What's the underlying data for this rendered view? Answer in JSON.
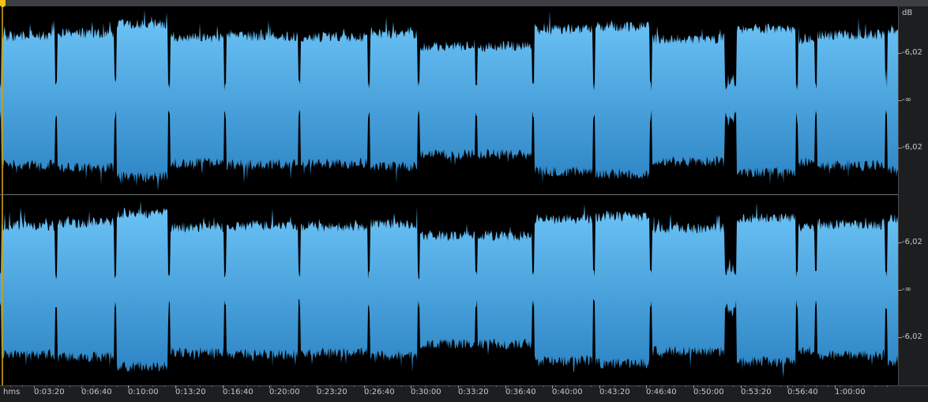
{
  "colors": {
    "background": "#000000",
    "wave_top": "#6ec5f8",
    "wave_bottom": "#2a82c2",
    "playhead": "#f1c40f",
    "ruler_text": "#c8c8c8"
  },
  "db_ruler": {
    "unit_label": "dB",
    "channels": [
      {
        "name": "top",
        "labels": [
          "-6,02",
          "-∞",
          "-6,02"
        ]
      },
      {
        "name": "bottom",
        "labels": [
          "-6,02",
          "-∞",
          "-6,02"
        ]
      }
    ]
  },
  "time_ruler": {
    "unit_label": "hms",
    "labels": [
      "0:03:20",
      "0:06:40",
      "0:10:00",
      "0:13:20",
      "0:16:40",
      "0:20:00",
      "0:23:20",
      "0:26:40",
      "0:30:00",
      "0:33:20",
      "0:36:40",
      "0:40:00",
      "0:43:20",
      "0:46:40",
      "0:50:00",
      "0:53:20",
      "0:56:40",
      "1:00:00"
    ]
  },
  "waveform": {
    "segments": [
      {
        "start": 0.0,
        "end": 1.19,
        "level": 0.63
      },
      {
        "start": 1.19,
        "end": 2.45,
        "level": 0.66
      },
      {
        "start": 2.45,
        "end": 3.58,
        "level": 0.76
      },
      {
        "start": 3.58,
        "end": 4.78,
        "level": 0.61
      },
      {
        "start": 4.78,
        "end": 6.35,
        "level": 0.63
      },
      {
        "start": 6.35,
        "end": 7.82,
        "level": 0.62
      },
      {
        "start": 7.82,
        "end": 8.87,
        "level": 0.65
      },
      {
        "start": 8.87,
        "end": 10.1,
        "level": 0.52
      },
      {
        "start": 10.1,
        "end": 11.3,
        "level": 0.52
      },
      {
        "start": 11.3,
        "end": 12.6,
        "level": 0.7
      },
      {
        "start": 12.6,
        "end": 13.8,
        "level": 0.73
      },
      {
        "start": 13.8,
        "end": 15.4,
        "level": 0.6
      },
      {
        "start": 15.4,
        "end": 15.6,
        "level": 0.16
      },
      {
        "start": 15.6,
        "end": 16.9,
        "level": 0.71
      },
      {
        "start": 16.9,
        "end": 17.3,
        "level": 0.6
      },
      {
        "start": 17.3,
        "end": 18.8,
        "level": 0.64
      },
      {
        "start": 18.8,
        "end": 19.9,
        "level": 0.7
      }
    ]
  }
}
